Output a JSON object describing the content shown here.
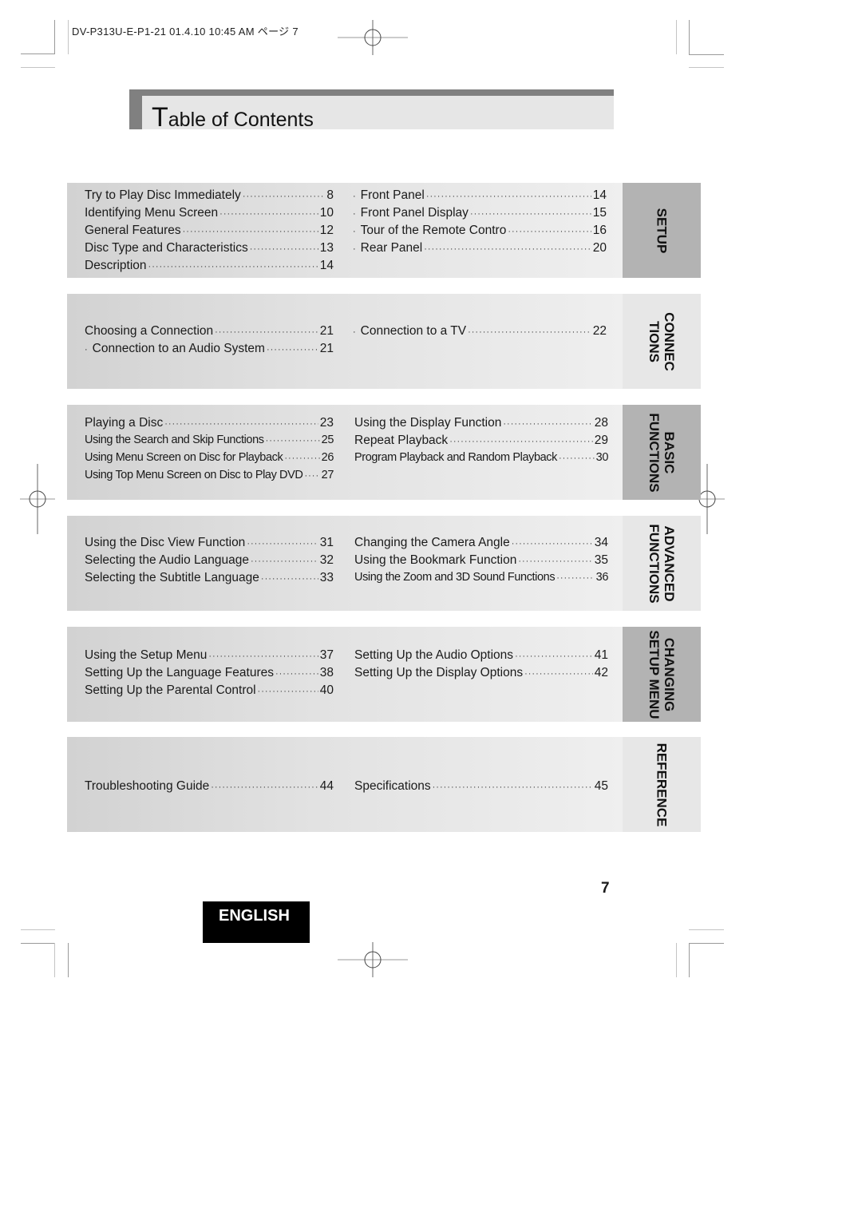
{
  "print_header": "DV-P313U-E-P1-21  01.4.10 10:45 AM  ページ 7",
  "title": {
    "first_letter": "T",
    "rest": "able of Contents"
  },
  "sections": [
    {
      "tab": [
        "SETUP"
      ],
      "tab_style": "dark",
      "left": [
        {
          "label": "Try to Play Disc Immediately",
          "page": "8",
          "bullet": false
        },
        {
          "label": "Identifying Menu Screen",
          "page": "10",
          "bullet": false
        },
        {
          "label": "General Features",
          "page": "12",
          "bullet": false
        },
        {
          "label": "Disc Type and Characteristics",
          "page": "13",
          "bullet": false
        },
        {
          "label": "Description",
          "page": "14",
          "bullet": false
        }
      ],
      "right": [
        {
          "label": "Front Panel",
          "page": "14",
          "bullet": true
        },
        {
          "label": "Front Panel Display",
          "page": "15",
          "bullet": true
        },
        {
          "label": "Tour of the Remote Contro",
          "page": "16",
          "bullet": true
        },
        {
          "label": "Rear Panel",
          "page": "20",
          "bullet": true
        }
      ]
    },
    {
      "tab": [
        "CONNEC",
        "TIONS"
      ],
      "tab_style": "light",
      "left": [
        {
          "label": "Choosing a Connection",
          "page": "21",
          "bullet": false
        },
        {
          "label": "Connection to an Audio System",
          "page": "21",
          "bullet": true
        }
      ],
      "right": [
        {
          "label": "Connection to a TV",
          "page": "22",
          "bullet": true
        }
      ]
    },
    {
      "tab": [
        "BASIC",
        "FUNCTIONS"
      ],
      "tab_style": "dark",
      "left": [
        {
          "label": "Playing a Disc",
          "page": "23",
          "bullet": false
        },
        {
          "label": "Using the Search and Skip Functions",
          "page": "25",
          "bullet": false
        },
        {
          "label": "Using Menu Screen on Disc for Playback",
          "page": "26",
          "bullet": false
        },
        {
          "label": "Using Top Menu Screen on Disc to Play DVD",
          "page": "27",
          "bullet": false
        }
      ],
      "right": [
        {
          "label": "Using the Display Function",
          "page": "28",
          "bullet": false
        },
        {
          "label": "Repeat Playback",
          "page": "29",
          "bullet": false
        },
        {
          "label": "Program Playback and Random Playback",
          "page": "30",
          "bullet": false
        }
      ]
    },
    {
      "tab": [
        "ADVANCED",
        "FUNCTIONS"
      ],
      "tab_style": "light",
      "left": [
        {
          "label": "Using the Disc View Function",
          "page": "31",
          "bullet": false
        },
        {
          "label": "Selecting the Audio Language",
          "page": "32",
          "bullet": false
        },
        {
          "label": "Selecting the Subtitle Language",
          "page": "33",
          "bullet": false
        }
      ],
      "right": [
        {
          "label": "Changing the Camera Angle",
          "page": "34",
          "bullet": false
        },
        {
          "label": "Using the Bookmark Function",
          "page": "35",
          "bullet": false
        },
        {
          "label": "Using the Zoom and 3D Sound Functions",
          "page": "36",
          "bullet": false
        }
      ]
    },
    {
      "tab": [
        "CHANGING",
        "SETUP MENU"
      ],
      "tab_style": "dark",
      "left": [
        {
          "label": "Using the Setup Menu",
          "page": "37",
          "bullet": false
        },
        {
          "label": "Setting Up the Language Features",
          "page": "38",
          "bullet": false
        },
        {
          "label": "Setting Up the Parental Control",
          "page": "40",
          "bullet": false
        }
      ],
      "right": [
        {
          "label": "Setting Up the Audio Options",
          "page": "41",
          "bullet": false
        },
        {
          "label": "Setting Up the Display Options",
          "page": "42",
          "bullet": false
        }
      ]
    },
    {
      "tab": [
        "REFERENCE"
      ],
      "tab_style": "light",
      "left": [
        {
          "label": "Troubleshooting Guide",
          "page": "44",
          "bullet": false
        }
      ],
      "right": [
        {
          "label": "Specifications",
          "page": "45",
          "bullet": false
        }
      ]
    }
  ],
  "footer": {
    "page_number": "7",
    "language_badge": "ENGLISH"
  },
  "icons": {
    "bullet": "·",
    "registration_mark": "crosshair-circle"
  }
}
